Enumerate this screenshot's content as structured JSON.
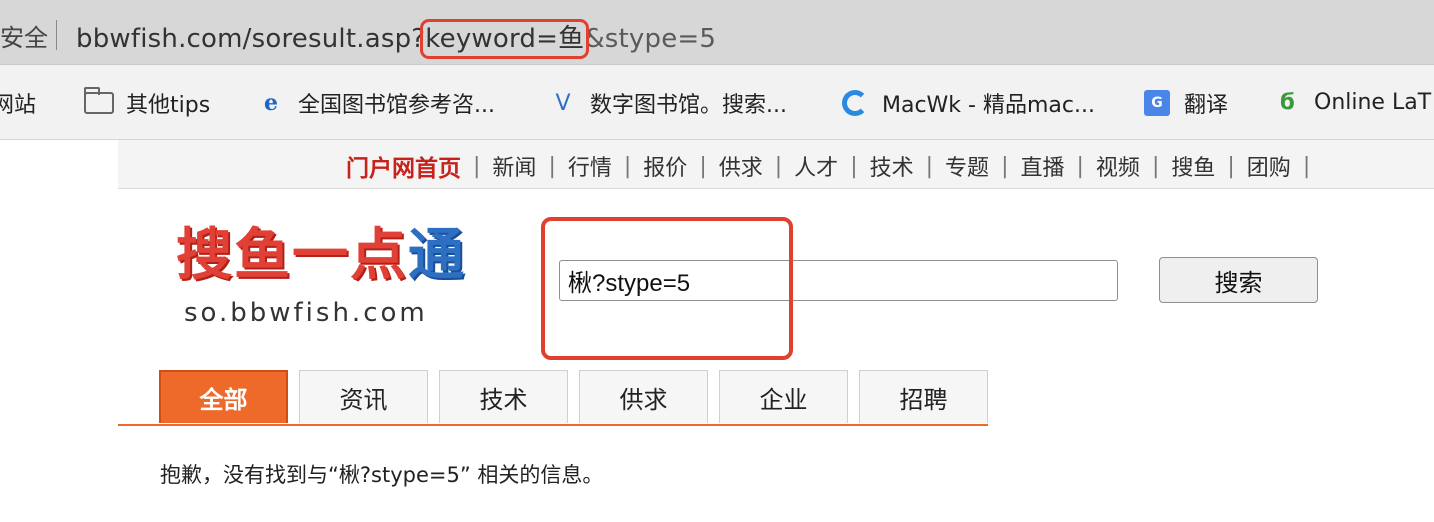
{
  "url_bar": {
    "insecure_label": "安全",
    "url_prefix": "bbwfish.com/soresult.asp?",
    "url_highlight": "keyword=鱼",
    "url_suffix": "&stype=5"
  },
  "bookmarks": [
    {
      "icon": "globe-icon",
      "label": "网站"
    },
    {
      "icon": "folder-icon",
      "label": "其他tips"
    },
    {
      "icon": "ie-icon",
      "label": "全国图书馆参考咨..."
    },
    {
      "icon": "v-icon",
      "label": "数字图书馆。搜索..."
    },
    {
      "icon": "c-icon",
      "label": "MacWk - 精品mac..."
    },
    {
      "icon": "translate-icon",
      "label": "翻译"
    },
    {
      "icon": "leaf-icon",
      "label": "Online LaT"
    }
  ],
  "topnav": [
    "门户网首页",
    "新闻",
    "行情",
    "报价",
    "供求",
    "人才",
    "技术",
    "专题",
    "直播",
    "视频",
    "搜鱼",
    "团购"
  ],
  "logo": {
    "main_red": "搜鱼一点",
    "main_blue": "通",
    "sub": "so.bbwfish.com"
  },
  "search": {
    "value": "楸?stype=5",
    "button": "搜索"
  },
  "tabs": [
    "全部",
    "资讯",
    "技术",
    "供求",
    "企业",
    "招聘"
  ],
  "active_tab": "全部",
  "message": "抱歉，没有找到与“楸?stype=5” 相关的信息。",
  "colors": {
    "accent_orange": "#ee6a2a",
    "highlight_red": "#e0402f",
    "home_link_red": "#c8201b"
  }
}
